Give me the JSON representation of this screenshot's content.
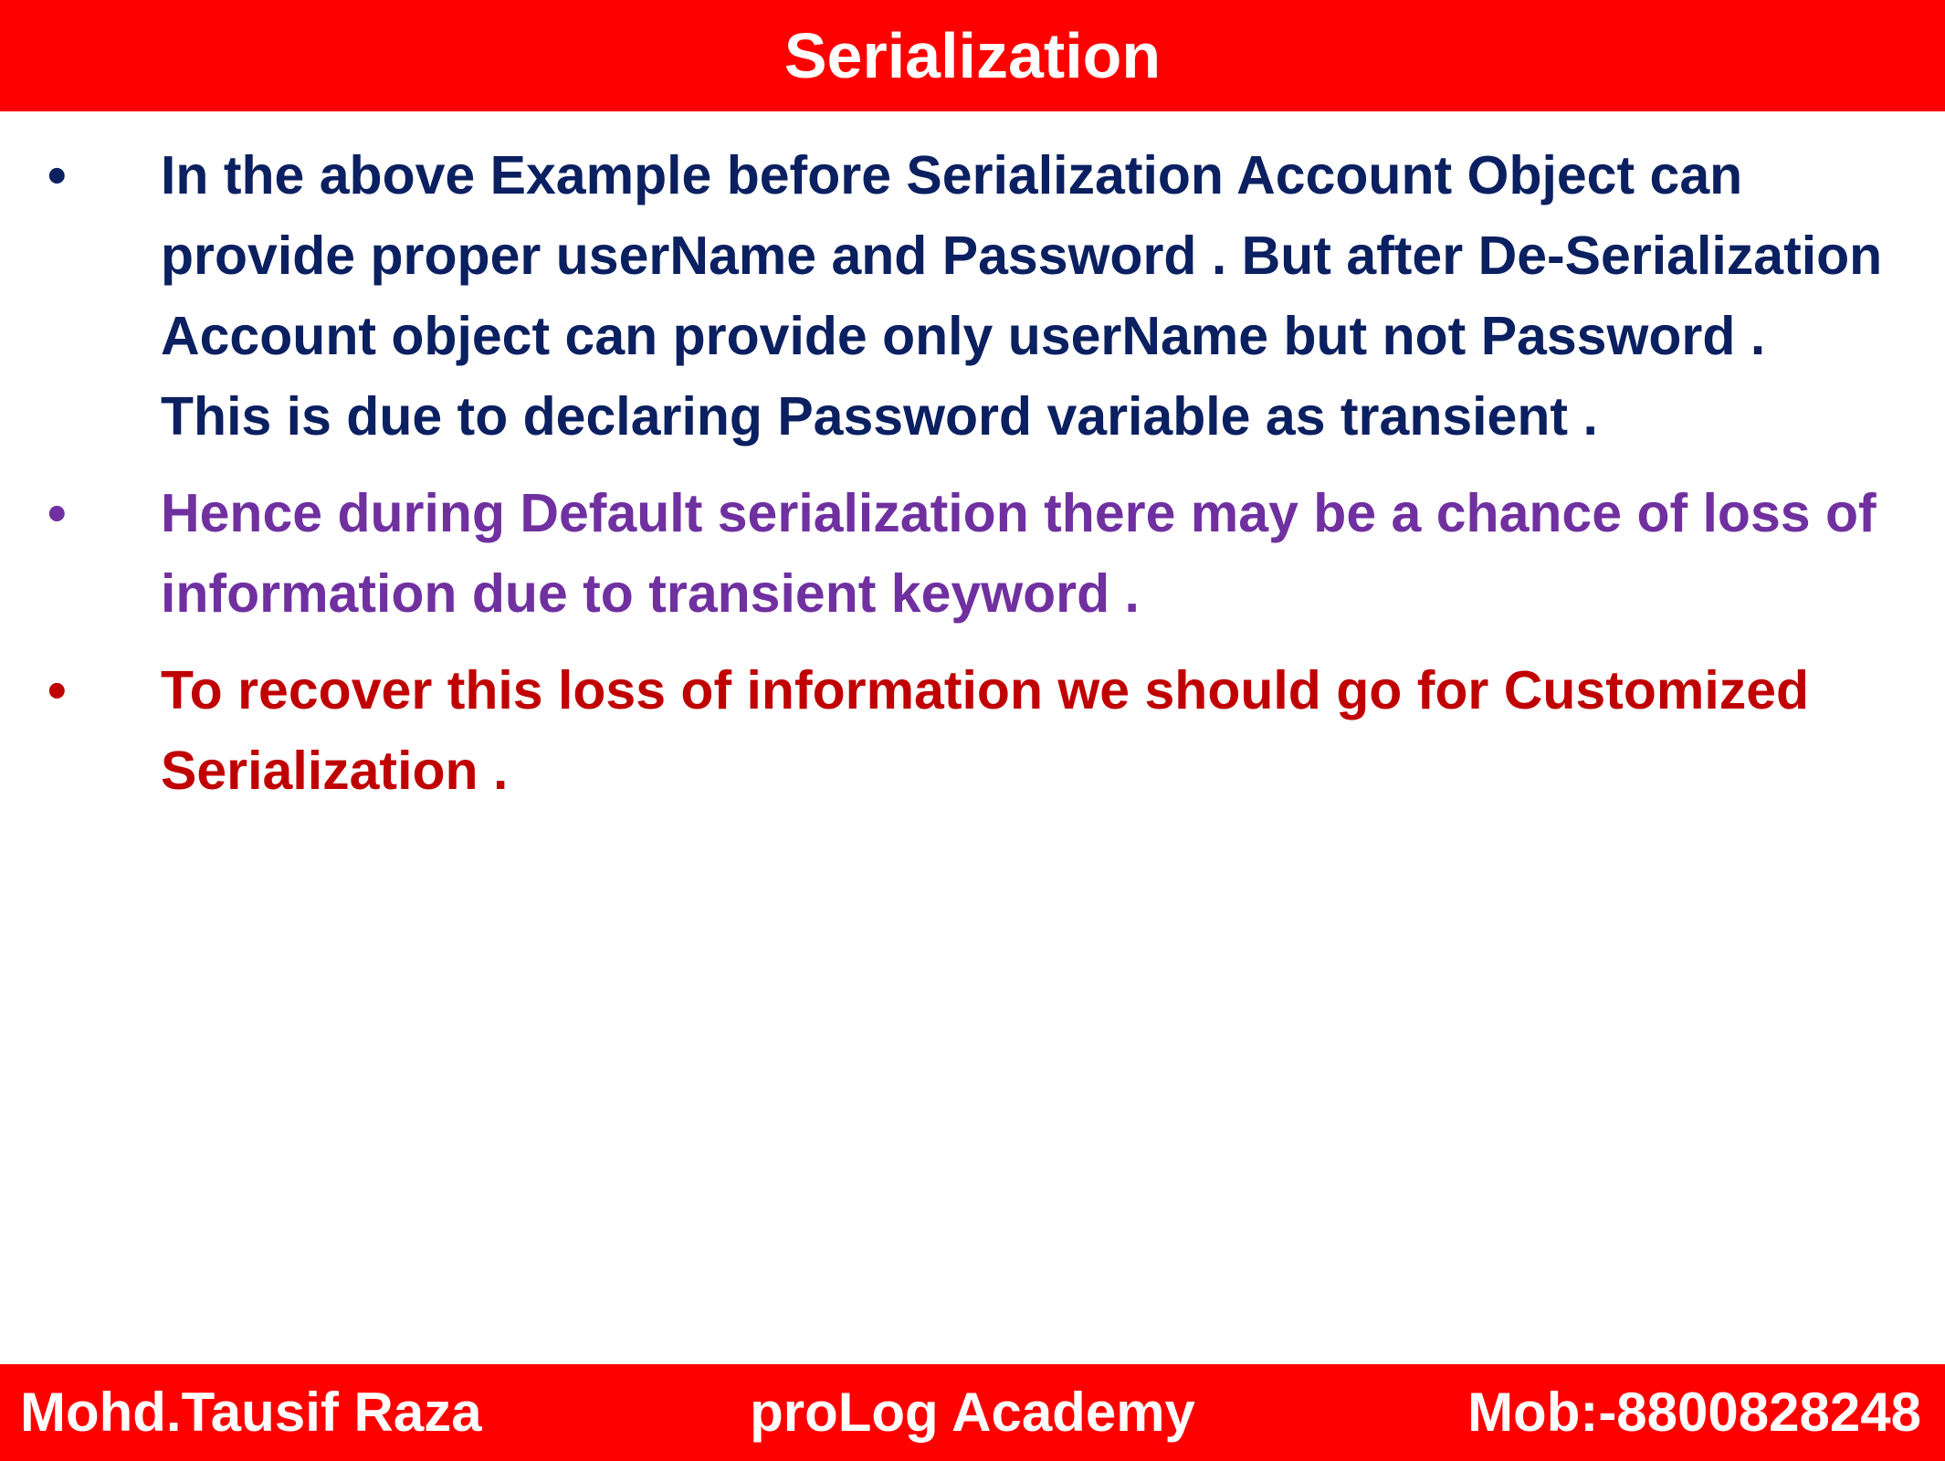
{
  "header": {
    "title": "Serialization",
    "background": "#ff0000"
  },
  "bullets": [
    {
      "marker": "•",
      "text": "In the above Example before Serialization Account Object can provide proper userName and Password . But after De-Serialization Account object can provide only userName but not Password . This is due to declaring Password variable as transient .",
      "color": "#0b2060"
    },
    {
      "marker": "•",
      "text": "Hence during Default serialization there may be a chance of loss of information due to transient keyword .",
      "color": "#7030a0"
    },
    {
      "marker": "•",
      "text": "To recover this loss of information we should go for Customized  Serialization .",
      "color": "#c00000"
    }
  ],
  "footer": {
    "left": "Mohd.Tausif Raza",
    "center": "proLog Academy",
    "right": "Mob:-8800828248",
    "background": "#ff0000"
  }
}
